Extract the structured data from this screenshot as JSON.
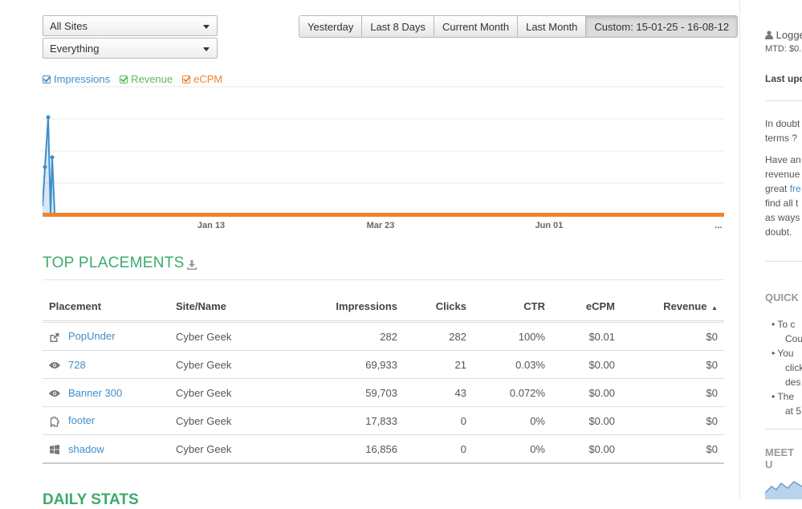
{
  "filters": {
    "site": "All Sites",
    "type": "Everything"
  },
  "date_range": {
    "buttons": [
      "Yesterday",
      "Last 8 Days",
      "Current Month",
      "Last Month",
      "Custom: 15-01-25 - 16-08-12"
    ],
    "active": "Custom: 15-01-25 - 16-08-12"
  },
  "legend": [
    {
      "label": "Impressions",
      "color": "#3f8ec9"
    },
    {
      "label": "Revenue",
      "color": "#5cb85c"
    },
    {
      "label": "eCPM",
      "color": "#f0832c"
    }
  ],
  "chart_data": {
    "type": "line",
    "x_tick_labels": [
      "Jan 13",
      "Mar 23",
      "Jun 01",
      "..."
    ],
    "series": [
      {
        "name": "Impressions",
        "color": "#3f8ec9"
      },
      {
        "name": "Revenue",
        "color": "#5cb85c"
      },
      {
        "name": "eCPM",
        "color": "#f0832c"
      }
    ],
    "grid": true
  },
  "top_placements": {
    "title": "TOP PLACEMENTS",
    "columns": [
      "Placement",
      "Site/Name",
      "Impressions",
      "Clicks",
      "CTR",
      "eCPM",
      "Revenue"
    ],
    "sort_indicator": "▲",
    "rows": [
      {
        "icon": "external-link-icon",
        "placement": "PopUnder",
        "site": "Cyber Geek",
        "impressions": "282",
        "clicks": "282",
        "ctr": "100%",
        "ecpm": "$0.01",
        "revenue": "$0"
      },
      {
        "icon": "eye-icon",
        "placement": "728",
        "site": "Cyber Geek",
        "impressions": "69,933",
        "clicks": "21",
        "ctr": "0.03%",
        "ecpm": "$0.00",
        "revenue": "$0"
      },
      {
        "icon": "eye-icon",
        "placement": "Banner 300",
        "site": "Cyber Geek",
        "impressions": "59,703",
        "clicks": "43",
        "ctr": "0.072%",
        "ecpm": "$0.00",
        "revenue": "$0"
      },
      {
        "icon": "puzzle-icon",
        "placement": "footer",
        "site": "Cyber Geek",
        "impressions": "17,833",
        "clicks": "0",
        "ctr": "0%",
        "ecpm": "$0.00",
        "revenue": "$0"
      },
      {
        "icon": "windows-icon",
        "placement": "shadow",
        "site": "Cyber Geek",
        "impressions": "16,856",
        "clicks": "0",
        "ctr": "0%",
        "ecpm": "$0.00",
        "revenue": "$0"
      }
    ]
  },
  "next_section_title": "DAILY STATS",
  "sidebar": {
    "logged": "Logge",
    "mtd": "MTD:  $0.",
    "last_updated": "Last upd",
    "doubt_lines": [
      "In doubt",
      "terms ? "
    ],
    "help_lines": [
      "Have an",
      "revenue",
      "great ",
      "find all t",
      "as ways",
      "doubt."
    ],
    "help_link": "fre",
    "quick_title": "QUICK",
    "quick_items": [
      [
        "To c",
        "Cou"
      ],
      [
        "You",
        "click",
        "des"
      ],
      [
        "The",
        "at 5"
      ]
    ],
    "meet_title": "MEET U"
  }
}
